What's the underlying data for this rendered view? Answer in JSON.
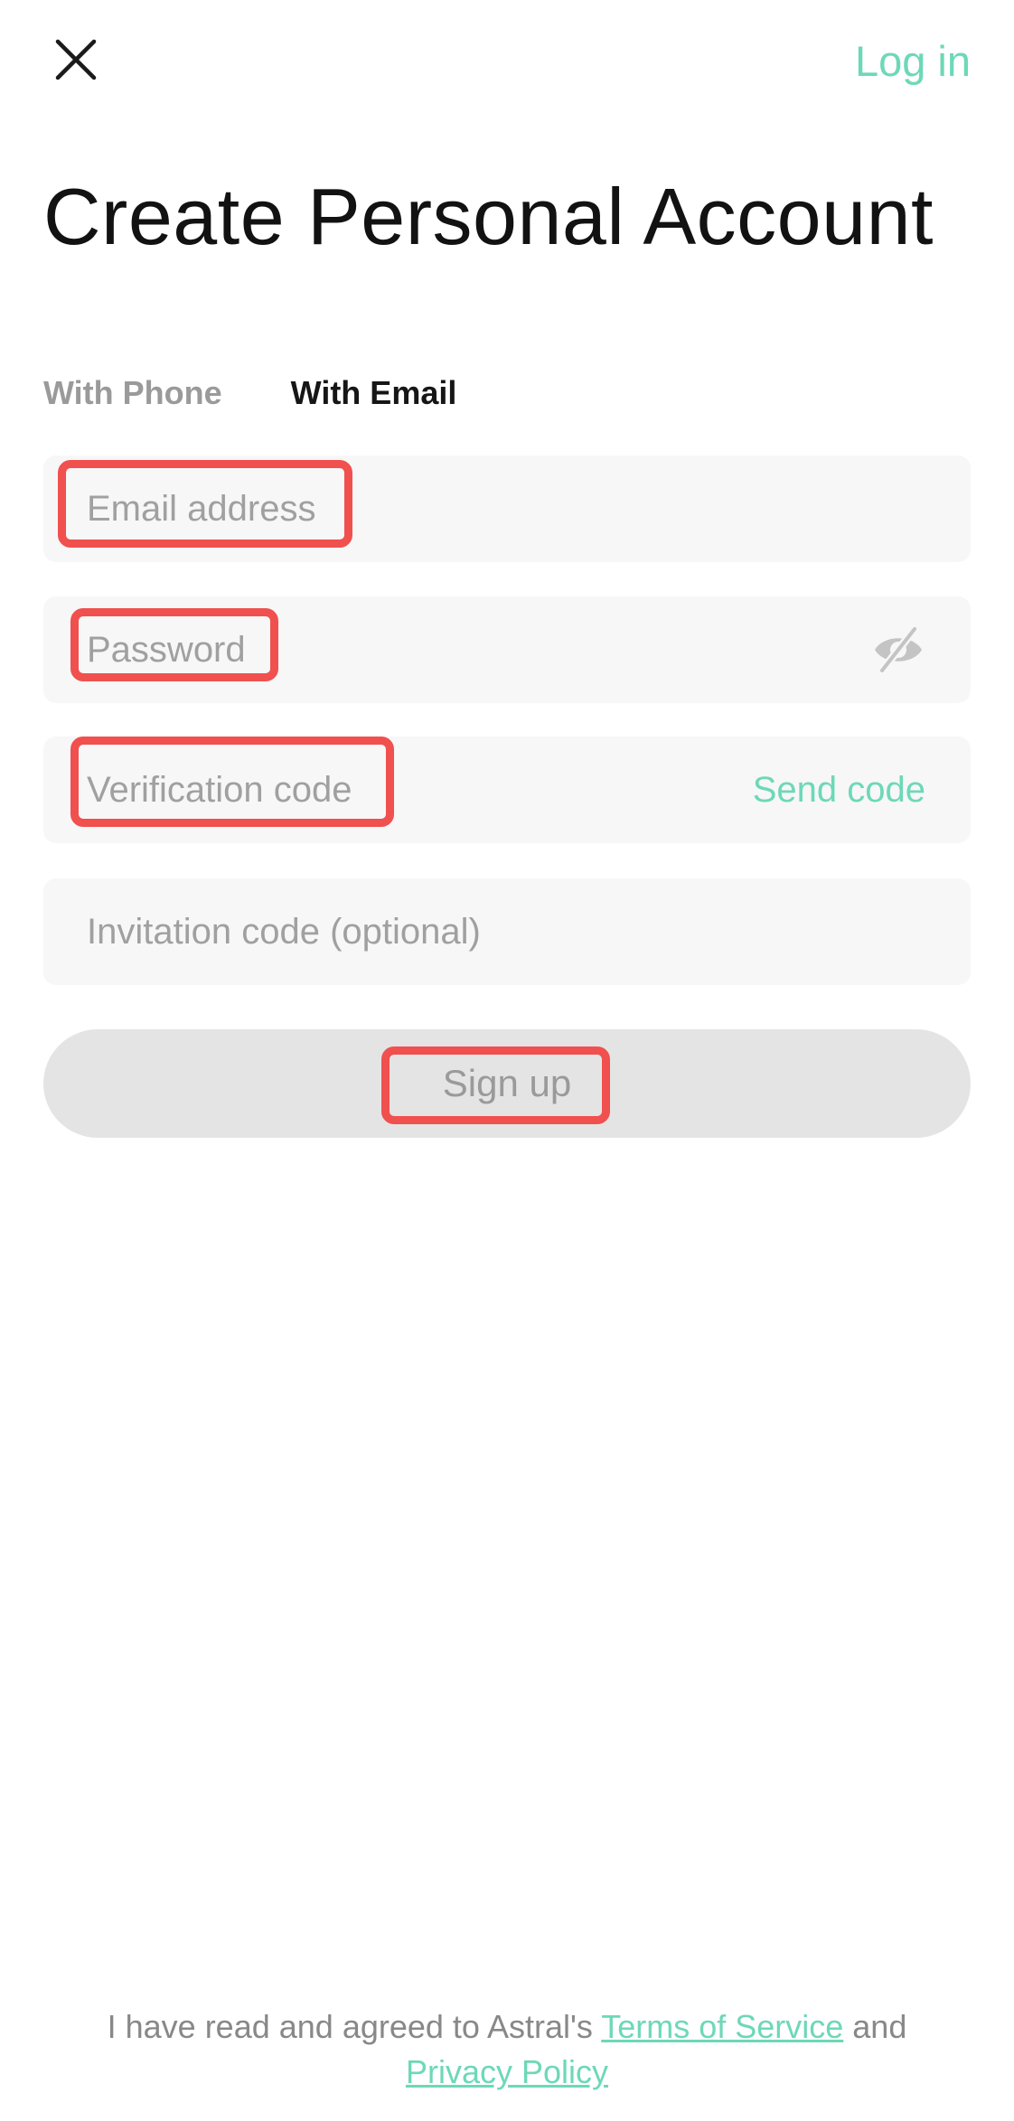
{
  "header": {
    "close_icon": "close-icon",
    "login_label": "Log in"
  },
  "title": "Create Personal Account",
  "tabs": [
    {
      "label": "With Phone",
      "active": false
    },
    {
      "label": "With Email",
      "active": true
    }
  ],
  "form": {
    "email_placeholder": "Email address",
    "password_placeholder": "Password",
    "password_toggle_icon": "eye-off-icon",
    "verification_placeholder": "Verification code",
    "send_code_label": "Send code",
    "invitation_placeholder": "Invitation code (optional)",
    "signup_label": "Sign up"
  },
  "footer": {
    "prefix": "I have read and agreed to Astral's ",
    "terms_label": "Terms of Service",
    "middle": " and",
    "privacy_label": "Privacy Policy"
  },
  "colors": {
    "accent": "#6dd8b7",
    "highlight": "#f0504e",
    "field_bg": "#f7f7f7",
    "button_bg": "#e4e4e4"
  }
}
